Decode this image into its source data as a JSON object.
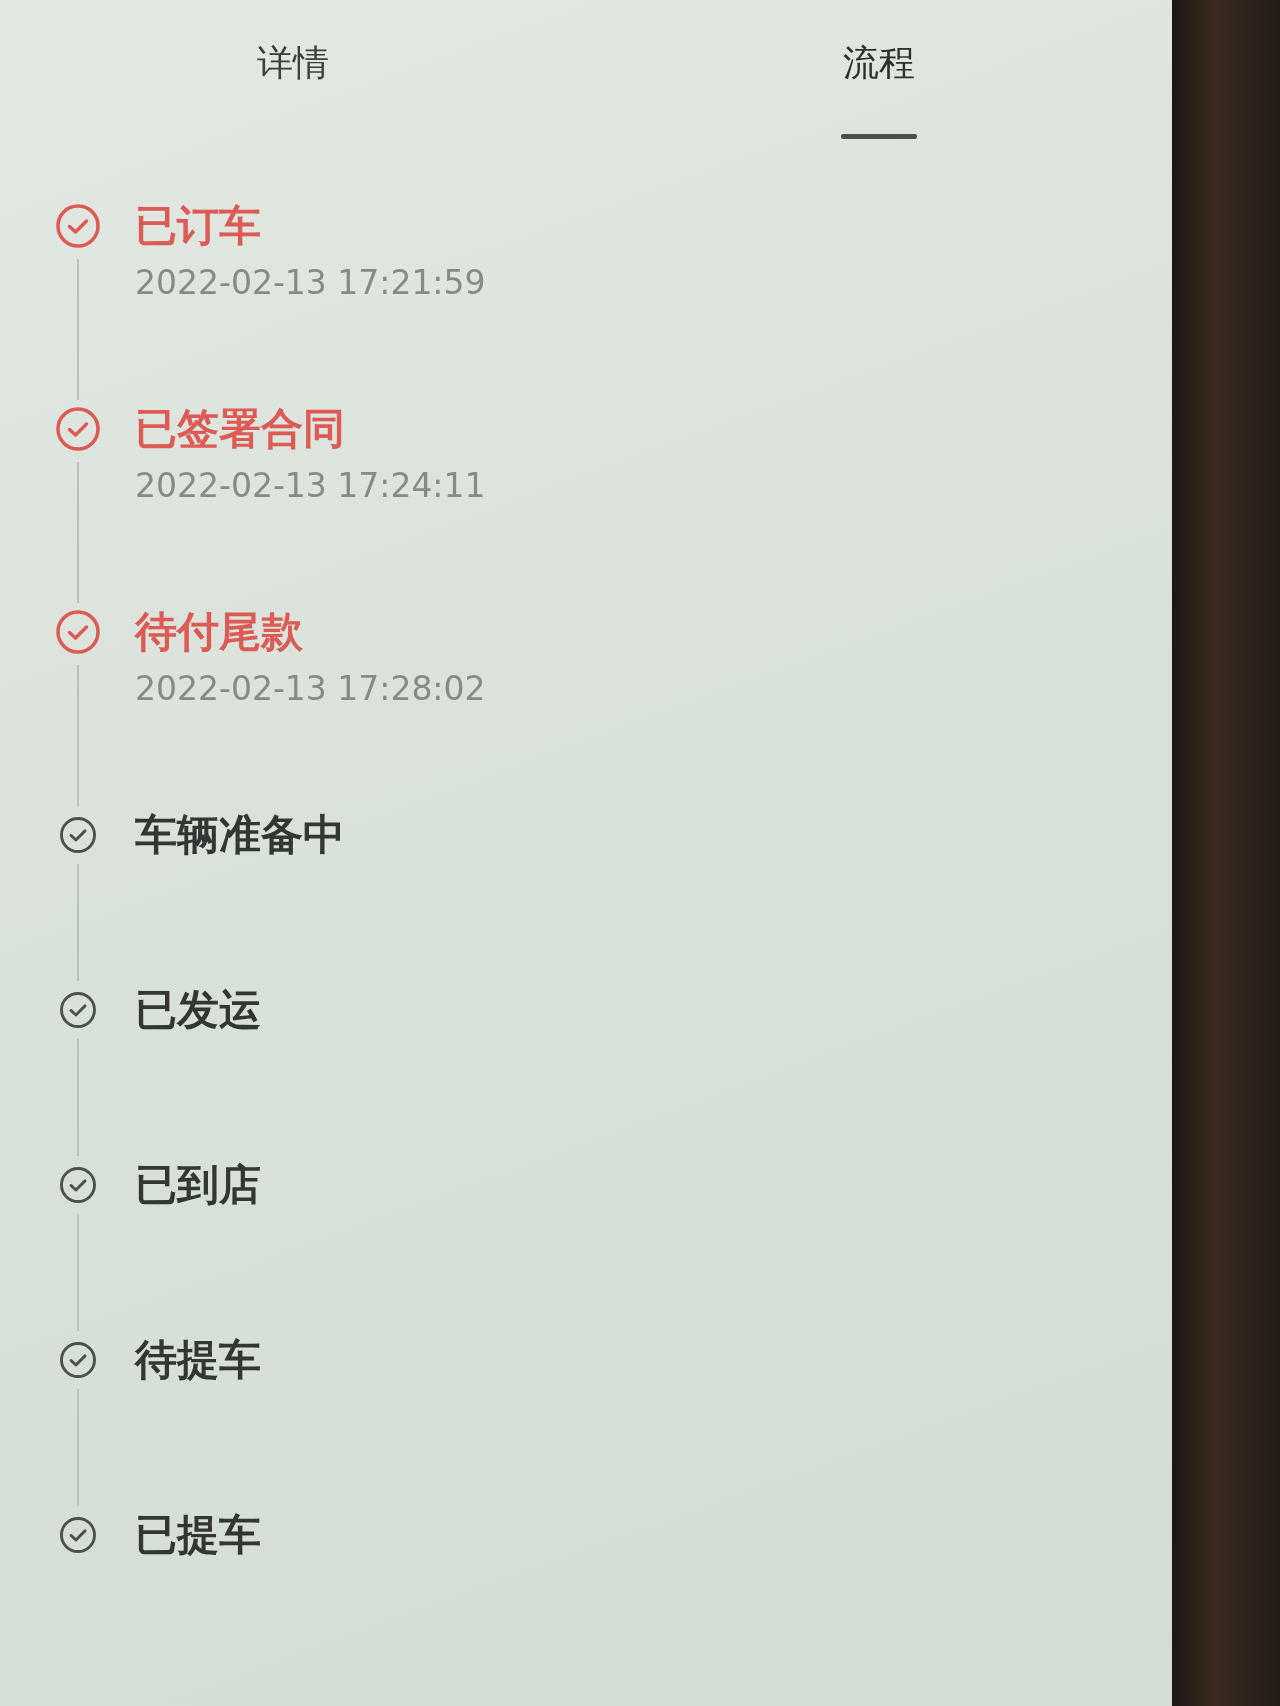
{
  "tabs": [
    {
      "label": "详情",
      "selected": false
    },
    {
      "label": "流程",
      "selected": true
    }
  ],
  "steps": [
    {
      "title": "已订车",
      "time": "2022-02-13 17:21:59",
      "done": true
    },
    {
      "title": "已签署合同",
      "time": "2022-02-13 17:24:11",
      "done": true
    },
    {
      "title": "待付尾款",
      "time": "2022-02-13 17:28:02",
      "done": true
    },
    {
      "title": "车辆准备中",
      "done": false
    },
    {
      "title": "已发运",
      "done": false
    },
    {
      "title": "已到店",
      "done": false
    },
    {
      "title": "待提车",
      "done": false
    },
    {
      "title": "已提车",
      "done": false
    }
  ]
}
